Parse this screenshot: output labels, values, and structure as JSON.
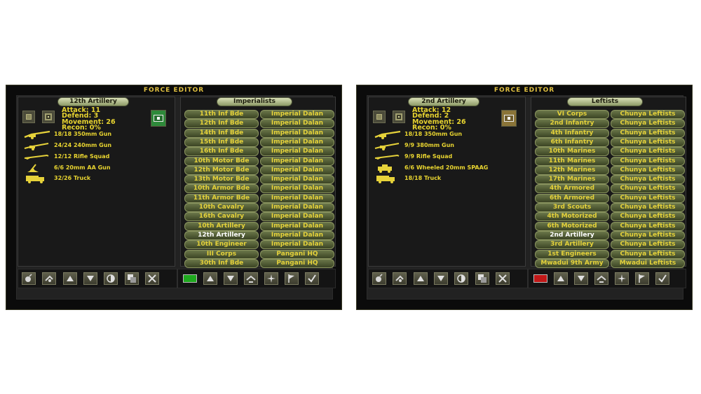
{
  "editors": [
    {
      "title": "FORCE EDITOR",
      "unit_tab": "12th Artillery",
      "side_tab": "Imperialists",
      "stats": {
        "attack": "Attack: 11",
        "defend": "Defend: 3",
        "movement": "Movement: 26",
        "recon": "Recon: 0%"
      },
      "flag_color": "#2e8a3a",
      "side_color": "#1ea81e",
      "equipment": [
        "18/18 350mm Gun",
        "24/24 240mm Gun",
        "12/12 Rifle Squad",
        "6/6 20mm AA Gun",
        "32/26 Truck"
      ],
      "equipment_icons": [
        "heavy-gun-icon",
        "gun-icon",
        "rifle-icon",
        "aa-gun-icon",
        "truck-icon"
      ],
      "units": [
        {
          "name": "11th Inf Bde",
          "owner": "Imperial Dalan"
        },
        {
          "name": "12th Inf Bde",
          "owner": "Imperial Dalan"
        },
        {
          "name": "14th Inf Bde",
          "owner": "Imperial Dalan"
        },
        {
          "name": "15th Inf Bde",
          "owner": "Imperial Dalan"
        },
        {
          "name": "16th Inf Bde",
          "owner": "Imperial Dalan"
        },
        {
          "name": "10th Motor Bde",
          "owner": "Imperial Dalan"
        },
        {
          "name": "12th Motor Bde",
          "owner": "Imperial Dalan"
        },
        {
          "name": "13th Motor Bde",
          "owner": "Imperial Dalan"
        },
        {
          "name": "10th Armor Bde",
          "owner": "Imperial Dalan"
        },
        {
          "name": "11th Armor Bde",
          "owner": "Imperial Dalan"
        },
        {
          "name": "10th Cavalry",
          "owner": "Imperial Dalan"
        },
        {
          "name": "16th Cavalry",
          "owner": "Imperial Dalan"
        },
        {
          "name": "10th Artillery",
          "owner": "Imperial Dalan"
        },
        {
          "name": "12th Artillery",
          "owner": "Imperial Dalan"
        },
        {
          "name": "10th Engineer",
          "owner": "Imperial Dalan"
        },
        {
          "name": "III Corps",
          "owner": "Pangani HQ"
        },
        {
          "name": "30th Inf Bde",
          "owner": "Pangani HQ"
        }
      ],
      "selected_index": 13
    },
    {
      "title": "FORCE EDITOR",
      "unit_tab": "2nd Artillery",
      "side_tab": "Leftists",
      "stats": {
        "attack": "Attack: 12",
        "defend": "Defend: 2",
        "movement": "Movement: 26",
        "recon": "Recon: 0%"
      },
      "flag_color": "#8a7438",
      "side_color": "#c01818",
      "equipment": [
        "18/18 350mm Gun",
        "9/9 380mm Gun",
        "9/9 Rifle Squad",
        "6/6 Wheeled 20mm SPAAG",
        "18/18 Truck"
      ],
      "equipment_icons": [
        "heavy-gun-icon",
        "gun-icon",
        "rifle-icon",
        "spaag-icon",
        "truck-icon"
      ],
      "units": [
        {
          "name": "VI Corps",
          "owner": "Chunya Leftists"
        },
        {
          "name": "2nd Infantry",
          "owner": "Chunya Leftists"
        },
        {
          "name": "4th Infantry",
          "owner": "Chunya Leftists"
        },
        {
          "name": "6th Infantry",
          "owner": "Chunya Leftists"
        },
        {
          "name": "10th Marines",
          "owner": "Chunya Leftists"
        },
        {
          "name": "11th Marines",
          "owner": "Chunya Leftists"
        },
        {
          "name": "12th Marines",
          "owner": "Chunya Leftists"
        },
        {
          "name": "17th Marines",
          "owner": "Chunya Leftists"
        },
        {
          "name": "4th Armored",
          "owner": "Chunya Leftists"
        },
        {
          "name": "6th Armored",
          "owner": "Chunya Leftists"
        },
        {
          "name": "3rd Scouts",
          "owner": "Chunya Leftists"
        },
        {
          "name": "4th Motorized",
          "owner": "Chunya Leftists"
        },
        {
          "name": "6th Motorized",
          "owner": "Chunya Leftists"
        },
        {
          "name": "2nd Artillery",
          "owner": "Chunya Leftists"
        },
        {
          "name": "3rd Artillery",
          "owner": "Chunya Leftists"
        },
        {
          "name": "1st Engineers",
          "owner": "Chunya Leftists"
        },
        {
          "name": "Mwadui 9th Army",
          "owner": "Mwadui Leftists"
        }
      ],
      "selected_index": 13
    }
  ]
}
